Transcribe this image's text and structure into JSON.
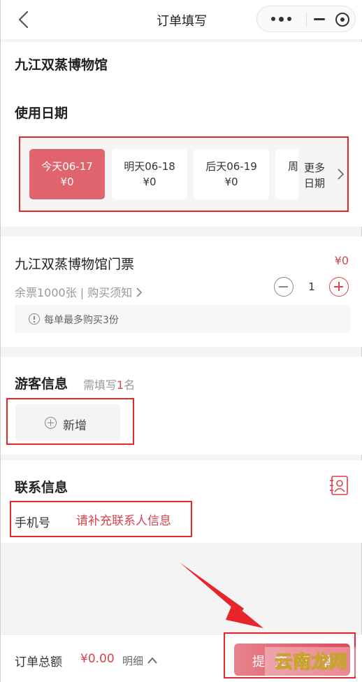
{
  "nav": {
    "title": "订单填写",
    "back_icon": "chevron-left-icon"
  },
  "capsule": {
    "more_icon": "more-dots-icon",
    "minimize_icon": "minimize-icon",
    "close_icon": "target-circle-icon"
  },
  "museum": {
    "name": "九江双蒸博物馆"
  },
  "date_section": {
    "title": "使用日期",
    "dates": [
      {
        "label": "今天06-17",
        "price": "¥0",
        "selected": true
      },
      {
        "label": "明天06-18",
        "price": "¥0",
        "selected": false
      },
      {
        "label": "后天06-19",
        "price": "¥0",
        "selected": false
      },
      {
        "label": "周",
        "price": "",
        "selected": false
      }
    ],
    "more_line1": "更多",
    "more_line2": "日期"
  },
  "ticket": {
    "name": "九江双蒸博物馆门票",
    "price": "¥0",
    "stock": "余票1000张 | 购买须知",
    "quantity": "1",
    "notice": "每单最多购买3份"
  },
  "visitor": {
    "title": "游客信息",
    "sub_prefix": "需填写",
    "sub_count": "1",
    "sub_suffix": "名",
    "add_label": "新增"
  },
  "contact": {
    "title": "联系信息",
    "phone_label": "手机号",
    "phone_placeholder": "请补充联系人信息"
  },
  "bottom": {
    "total_label": "订单总额",
    "total_value": "¥0.00",
    "detail_label": "明细",
    "submit_label": "提交订单"
  },
  "watermark": {
    "text": "云南龙网"
  },
  "colors": {
    "accent": "#e0646d",
    "price_red": "#d9414d",
    "annotation_red": "#e6262b"
  }
}
